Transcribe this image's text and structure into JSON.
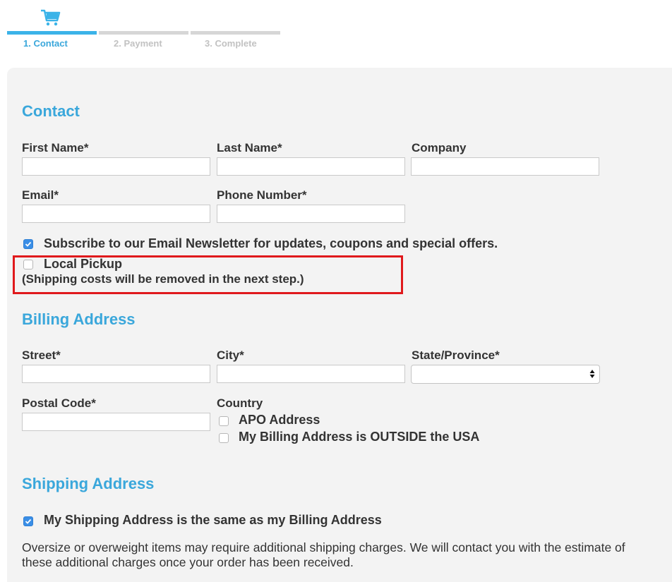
{
  "steps": [
    {
      "label": "1. Contact",
      "active": true
    },
    {
      "label": "2. Payment",
      "active": false
    },
    {
      "label": "3. Complete",
      "active": false
    }
  ],
  "icons": {
    "cart": "shopping-cart-icon",
    "check": "check-icon",
    "select_arrows": "up-down-arrows-icon"
  },
  "colors": {
    "accent": "#3aa7db",
    "step_active": "#3bb3e8",
    "step_inactive": "#d6d6d6",
    "checkbox_checked": "#3a8ee6",
    "highlight": "#e0191c",
    "panel": "#f3f3f3"
  },
  "contact": {
    "title": "Contact",
    "first_name": {
      "label": "First Name*",
      "value": ""
    },
    "last_name": {
      "label": "Last Name*",
      "value": ""
    },
    "company": {
      "label": "Company",
      "value": ""
    },
    "email": {
      "label": "Email*",
      "value": ""
    },
    "phone": {
      "label": "Phone Number*",
      "value": ""
    },
    "newsletter": {
      "label": "Subscribe to our Email Newsletter for updates, coupons and special offers.",
      "checked": true
    },
    "local_pickup": {
      "label": "Local Pickup",
      "checked": false,
      "note": "(Shipping costs will be removed in the next step.)"
    }
  },
  "billing": {
    "title": "Billing Address",
    "street": {
      "label": "Street*",
      "value": ""
    },
    "city": {
      "label": "City*",
      "value": ""
    },
    "state": {
      "label": "State/Province*",
      "selected": ""
    },
    "postal": {
      "label": "Postal Code*",
      "value": ""
    },
    "country": {
      "label": "Country"
    },
    "apo": {
      "label": "APO Address",
      "checked": false
    },
    "outside_usa": {
      "label": "My Billing Address is OUTSIDE the USA",
      "checked": false
    }
  },
  "shipping": {
    "title": "Shipping Address",
    "same_as_billing": {
      "label": "My Shipping Address is the same as my Billing Address",
      "checked": true
    },
    "oversize_note": "Oversize or overweight items may require additional shipping charges. We will contact you with the estimate of these additional charges once your order has been received."
  }
}
